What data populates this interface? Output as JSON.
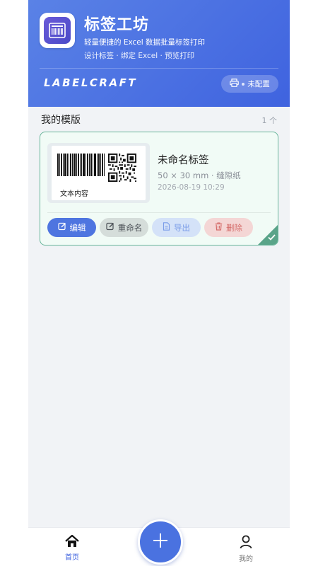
{
  "header": {
    "title": "标签工坊",
    "subtitle": "轻量便捷的 Excel 数据批量标签打印",
    "features": "设计标签 · 绑定 Excel · 预览打印",
    "wordmark": "LABELCRAFT",
    "printer_status": "未配置",
    "logo_icon": "label-printer-icon"
  },
  "templates": {
    "section_title": "我的模版",
    "count": "1 个",
    "items": [
      {
        "name": "未命名标签",
        "spec": "50 × 30 mm · 缝隙纸",
        "date": "2026-08-19 10:29",
        "preview_text": "文本内容",
        "selected": true
      }
    ],
    "actions": {
      "edit": "编辑",
      "rename": "重命名",
      "export": "导出",
      "delete": "删除"
    }
  },
  "nav": {
    "home": "首页",
    "mine": "我的",
    "add_icon": "plus-icon"
  },
  "colors": {
    "primary": "#3f63df",
    "card_border": "#67b59a",
    "danger": "#d46a68"
  }
}
